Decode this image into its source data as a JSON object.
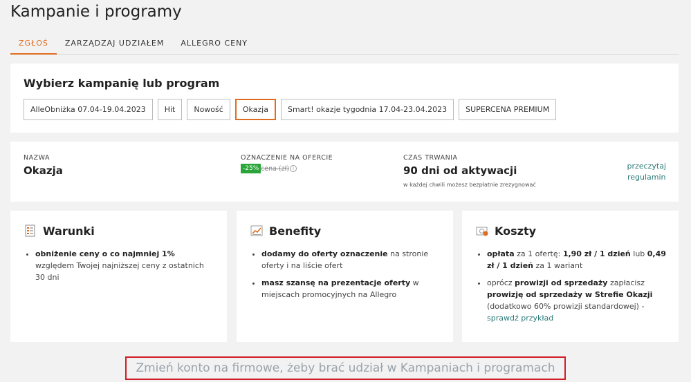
{
  "page": {
    "title": "Kampanie i programy"
  },
  "tabs": [
    {
      "label": "ZGŁOŚ"
    },
    {
      "label": "ZARZĄDZAJ UDZIAŁEM"
    },
    {
      "label": "ALLEGRO CENY"
    }
  ],
  "selector": {
    "title": "Wybierz kampanię lub program",
    "options": [
      {
        "label": "AlleObniżka 07.04-19.04.2023"
      },
      {
        "label": "Hit"
      },
      {
        "label": "Nowość"
      },
      {
        "label": "Okazja"
      },
      {
        "label": "Smart! okazje tygodnia 17.04-23.04.2023"
      },
      {
        "label": "SUPERCENA PREMIUM"
      }
    ],
    "selected": "Okazja"
  },
  "info": {
    "name_label": "NAZWA",
    "name_value": "Okazja",
    "mark_label": "OZNACZENIE NA OFERCIE",
    "mark_badge": "-25%",
    "mark_price": "cena (zł)",
    "duration_label": "CZAS TRWANIA",
    "duration_value": "90 dni od aktywacji",
    "duration_note": "w każdej chwili możesz bezpłatnie zrezygnować",
    "regulamin_line1": "przeczytaj",
    "regulamin_line2": "regulamin"
  },
  "warunki": {
    "title": "Warunki",
    "item1_bold": "obniżenie ceny o co najmniej 1%",
    "item1_rest": " względem Twojej najniższej ceny z ostatnich 30 dni"
  },
  "benefity": {
    "title": "Benefity",
    "item1_bold": "dodamy do oferty oznaczenie",
    "item1_rest": " na stronie oferty i na liście ofert",
    "item2_bold": "masz szansę na prezentacje oferty",
    "item2_rest": " w miejscach promocyjnych na Allegro"
  },
  "koszty": {
    "title": "Koszty",
    "item1_a": "opłata",
    "item1_b": " za 1 ofertę: ",
    "item1_c": "1,90 zł / 1 dzień",
    "item1_d": " lub ",
    "item1_e": "0,49 zł / 1 dzień",
    "item1_f": " za 1 wariant",
    "item2_a": "oprócz ",
    "item2_b": "prowizji od sprzedaży",
    "item2_c": " zapłacisz ",
    "item2_d": "prowizję od sprzedaży w Strefie Okazji",
    "item2_e": " (dodatkowo 60% prowizji standardowej) - ",
    "item2_link": "sprawdź przykład"
  },
  "cta": {
    "label": "Zmień konto na firmowe, żeby brać udział w Kampaniach i programach"
  },
  "colors": {
    "accent": "#e06d1f",
    "badge": "#2aa53a",
    "link": "#2b7a78",
    "cta_border": "#d01c24"
  },
  "icons": {
    "warunki": "document-list-icon",
    "benefity": "chart-up-icon",
    "koszty": "money-icon",
    "info": "info-icon"
  }
}
